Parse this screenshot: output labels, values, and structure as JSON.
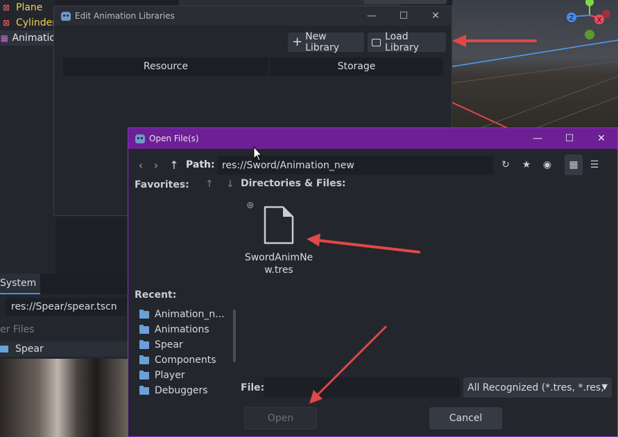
{
  "scene_tree": {
    "items": [
      {
        "label": "Plane",
        "icon": "mesh-icon"
      },
      {
        "label": "Cylinder",
        "icon": "mesh-icon"
      },
      {
        "label": "Animatio",
        "icon": "animation-player-icon"
      }
    ]
  },
  "filesystem": {
    "tab_label": "System",
    "path": "res://Spear/spear.tscn",
    "filter_label": "er Files",
    "folder_label": "Spear"
  },
  "anim_dialog": {
    "title": "Edit Animation Libraries",
    "new_library_label": "New Library",
    "load_library_label": "Load Library",
    "columns": [
      "Resource",
      "Storage"
    ]
  },
  "file_dialog": {
    "title": "Open File(s)",
    "path_label": "Path:",
    "path_value": "res://Sword/Animation_new",
    "favorites_label": "Favorites:",
    "dirs_label": "Directories & Files:",
    "file_item": {
      "name": "SwordAnimNew.tres",
      "icon": "document-icon",
      "badge_icon": "resource-icon"
    },
    "recent_label": "Recent:",
    "recent_items": [
      "Animation_n...",
      "Animations",
      "Spear",
      "Components",
      "Player",
      "Debuggers"
    ],
    "file_label": "File:",
    "file_value": "",
    "filter_value": "All Recognized (*.tres, *.res,",
    "open_label": "Open",
    "cancel_label": "Cancel"
  },
  "colors": {
    "dialog_title_bg": "#6c2094",
    "annotation_arrow": "#e04848",
    "folder": "#6aa0d8"
  }
}
